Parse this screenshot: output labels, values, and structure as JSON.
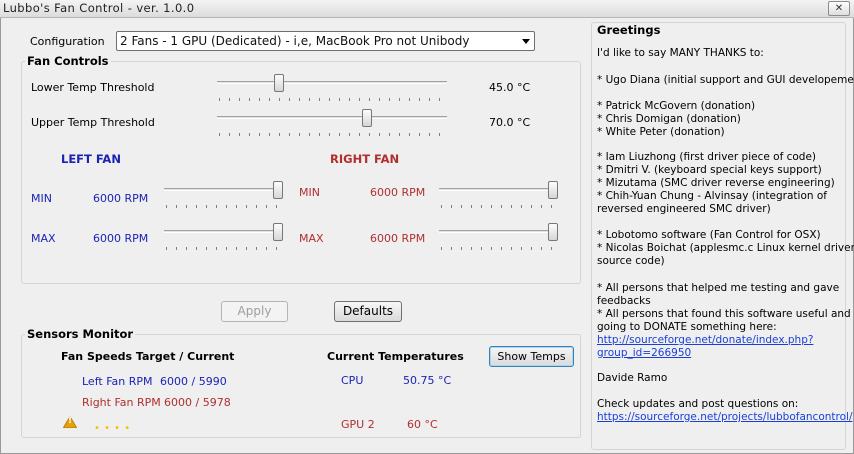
{
  "window": {
    "title": "Lubbo's Fan Control  -  ver. 1.0.0",
    "close_glyph": "✕"
  },
  "configuration": {
    "label": "Configuration",
    "value": "2 Fans - 1 GPU (Dedicated) - i,e, MacBook Pro not Unibody"
  },
  "fan_controls": {
    "title": "Fan Controls",
    "lower_label": "Lower Temp Threshold",
    "lower_value": "45.0 °C",
    "upper_label": "Upper Temp Threshold",
    "upper_value": "70.0 °C",
    "left_fan": {
      "title": "LEFT FAN",
      "min_label": "MIN",
      "min_value": "6000 RPM",
      "max_label": "MAX",
      "max_value": "6000 RPM"
    },
    "right_fan": {
      "title": "RIGHT FAN",
      "min_label": "MIN",
      "min_value": "6000 RPM",
      "max_label": "MAX",
      "max_value": "6000 RPM"
    }
  },
  "buttons": {
    "apply": "Apply",
    "defaults": "Defaults",
    "show_temps": "Show Temps"
  },
  "sensors": {
    "title": "Sensors Monitor",
    "fan_header": "Fan Speeds Target / Current",
    "left_label": "Left  Fan RPM",
    "left_value": "6000 / 5990",
    "right_label": "Right Fan RPM",
    "right_value": "6000 / 5978",
    "temp_header": "Current Temperatures",
    "cpu_label": "CPU",
    "cpu_value": "50.75 °C",
    "gpu_label": "GPU 2",
    "gpu_value": "60 °C",
    "warning_glyph": "!",
    "status_dots": "• • • •"
  },
  "greetings": {
    "title": "Greetings",
    "lines": [
      "I'd like to say MANY THANKS to:",
      "* Ugo Diana (initial support and GUI developement)",
      "* Patrick McGovern (donation)",
      "* Chris Domigan (donation)",
      "* White Peter (donation)",
      "* Iam Liuzhong (first driver piece of code)",
      "* Dmitri V. (keyboard special keys support)",
      "* Mizutama (SMC driver reverse engineering)",
      "* Chih-Yuan Chung - Alvinsay (integration of",
      "reversed engineered SMC driver)",
      "* Lobotomo software (Fan Control for OSX)",
      "* Nicolas Boichat (applesmc.c Linux kernel driver",
      "source code)",
      "* All persons that helped me testing and gave",
      "feedbacks",
      "* All persons that found this software useful and are",
      "going to DONATE something here:",
      "Davide Ramo",
      "Check updates and post questions on:"
    ],
    "donate_link_line1": "http://sourceforge.net/donate/index.php?",
    "donate_link_line2": "group_id=266950",
    "project_link": "https://sourceforge.net/projects/lubbofancontrol/"
  },
  "colors": {
    "left_accent": "#1b23b5",
    "right_accent": "#b02f2f",
    "link": "#1a3fd8",
    "warning": "#e8a100",
    "status_dots": "#f2c200"
  },
  "slider_levels": {
    "lower_threshold_fraction": 0.26,
    "upper_threshold_fraction": 0.66,
    "left_min_fraction": 1.0,
    "left_max_fraction": 1.0,
    "right_min_fraction": 1.0,
    "right_max_fraction": 1.0
  }
}
